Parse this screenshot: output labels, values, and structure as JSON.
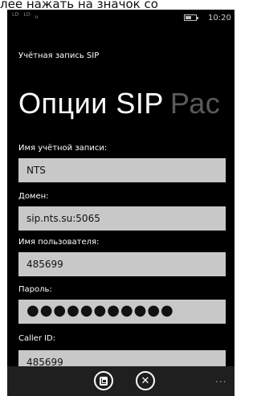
{
  "top_caption": "лее нажать на значок со",
  "status_bar": {
    "icons": [
      "ᴸᴰ",
      "ᴸᴰ",
      "ᵢᵢ"
    ],
    "battery_level": 0.5,
    "time": "10:20"
  },
  "app": {
    "title": "Учётная запись SIP"
  },
  "pivot": {
    "active": "Опции SIP",
    "inactive": "Рас"
  },
  "fields": [
    {
      "label": "Имя учётной записи:",
      "value": "NTS"
    },
    {
      "label": "Домен:",
      "value": "sip.nts.su:5065"
    },
    {
      "label": "Имя пользователя:",
      "value": "485699"
    },
    {
      "label": "Пароль:",
      "value": "●●●●●●●●●●●"
    },
    {
      "label": "Caller ID:",
      "value": "485699"
    }
  ],
  "app_bar": {
    "save_icon": "save-icon",
    "cancel_icon": "cancel-icon",
    "cancel_glyph": "✕",
    "more": "..."
  }
}
